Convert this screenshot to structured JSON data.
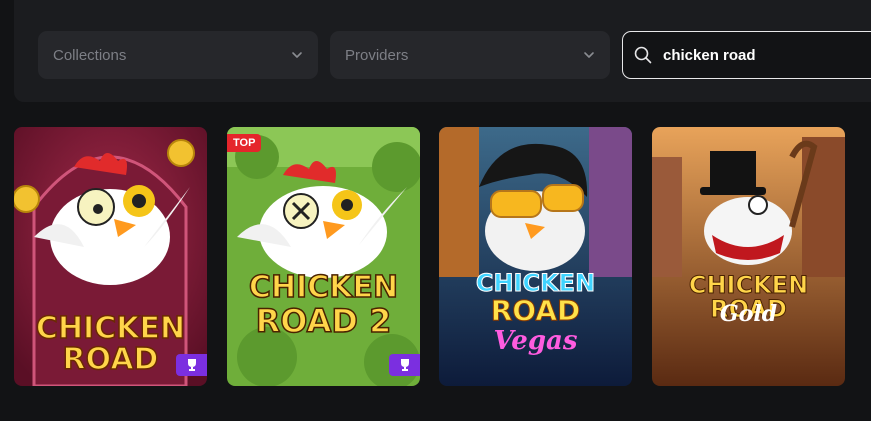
{
  "filters": {
    "collections_label": "Collections",
    "providers_label": "Providers",
    "search_value": "chicken road",
    "search_icon": "search-icon",
    "chevron_icon": "chevron-down-icon"
  },
  "games": [
    {
      "line1": "CHICKEN",
      "line2": "ROAD",
      "badge": "",
      "trophy": true
    },
    {
      "line1": "CHICKEN",
      "line2": "ROAD 2",
      "badge": "TOP",
      "trophy": true
    },
    {
      "line1": "CHICKEN",
      "line2": "ROAD",
      "line3": "Vegas",
      "badge": "",
      "trophy": false
    },
    {
      "line1": "CHICKEN ROAD",
      "line2": "Gold",
      "badge": "",
      "trophy": false
    }
  ],
  "colors": {
    "background": "#121315",
    "panel": "#1b1c1f",
    "dropdown": "#26272b",
    "badge_red": "#e5262b",
    "trophy_purple": "#7b2fe0"
  }
}
